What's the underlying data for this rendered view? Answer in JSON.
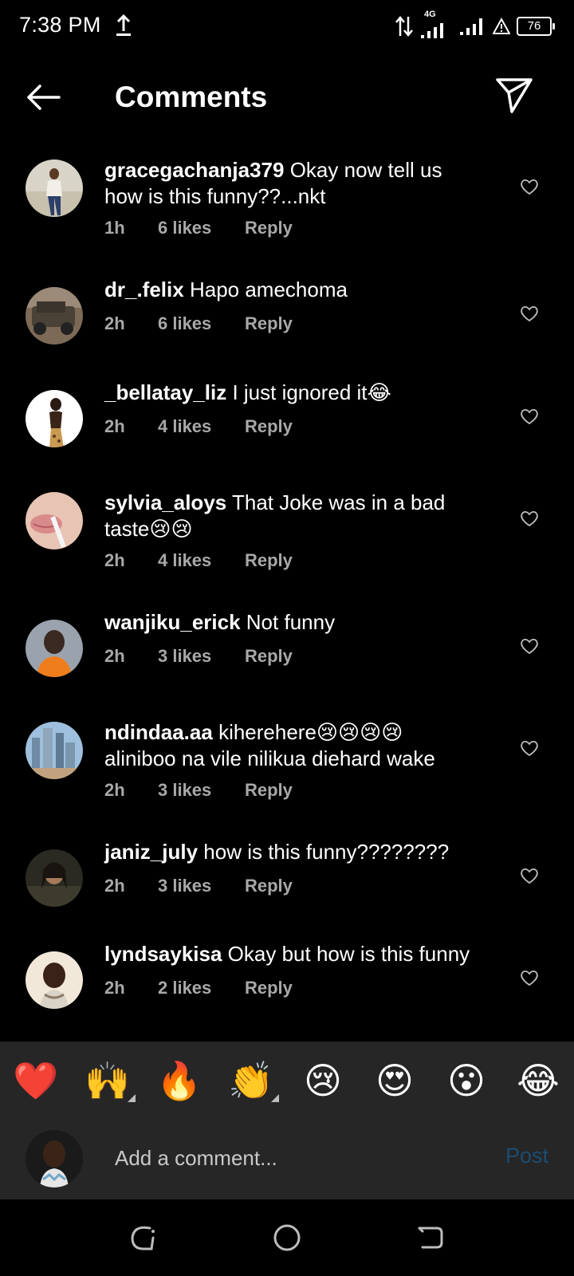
{
  "status_bar": {
    "time": "7:38 PM",
    "network_label": "4G",
    "battery": "76"
  },
  "header": {
    "title": "Comments"
  },
  "comments": [
    {
      "username": "gracegachanja379",
      "text": "Okay now tell us how is this funny??...nkt",
      "time": "1h",
      "likes": "6 likes",
      "reply": "Reply"
    },
    {
      "username": "dr_.felix",
      "text": "Hapo amechoma",
      "time": "2h",
      "likes": "6 likes",
      "reply": "Reply"
    },
    {
      "username": "_bellatay_liz",
      "text": "I just ignored it😂",
      "time": "2h",
      "likes": "4 likes",
      "reply": "Reply"
    },
    {
      "username": "sylvia_aloys",
      "text": "That Joke was in a bad taste😢😢",
      "time": "2h",
      "likes": "4 likes",
      "reply": "Reply"
    },
    {
      "username": "wanjiku_erick",
      "text": "Not funny",
      "time": "2h",
      "likes": "3 likes",
      "reply": "Reply"
    },
    {
      "username": "ndindaa.aa",
      "text": "kiherehere😢😢😢😢 aliniboo na vile nilikua diehard wake",
      "time": "2h",
      "likes": "3 likes",
      "reply": "Reply"
    },
    {
      "username": "janiz_july",
      "text": "how is this funny????????",
      "time": "2h",
      "likes": "3 likes",
      "reply": "Reply"
    },
    {
      "username": "lyndsaykisa",
      "text": "Okay but how is this funny",
      "time": "2h",
      "likes": "2 likes",
      "reply": "Reply"
    }
  ],
  "emoji_bar": [
    "❤️",
    "🙌",
    "🔥",
    "👏",
    "😢",
    "😍",
    "😮",
    "😂"
  ],
  "comment_bar": {
    "placeholder": "Add a comment...",
    "post_label": "Post"
  },
  "colors": {
    "background": "#000000",
    "panel": "#262626",
    "meta_text": "#a8a8a8",
    "post_disabled": "#1c4d72"
  }
}
